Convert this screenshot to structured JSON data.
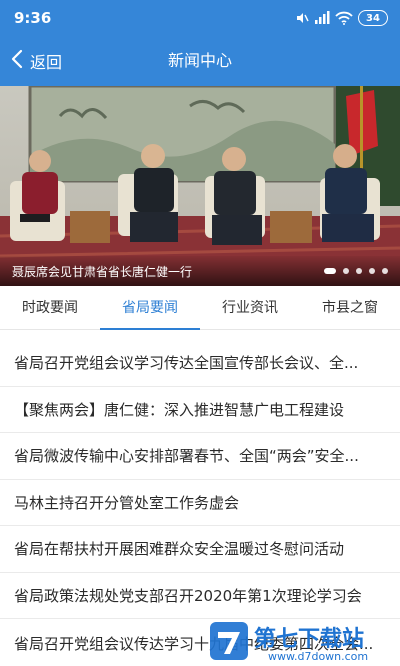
{
  "status_bar": {
    "time": "9:36",
    "battery": "34",
    "icons": [
      "mute-icon",
      "signal-icon",
      "wifi-icon",
      "battery-icon"
    ]
  },
  "nav": {
    "back_label": "返回",
    "title": "新闻中心"
  },
  "banner": {
    "caption": "聂辰席会见甘肃省省长唐仁健一行",
    "slide_count": 5,
    "active_slide": 0
  },
  "tabs": [
    {
      "label": "时政要闻",
      "active": false
    },
    {
      "label": "省局要闻",
      "active": true
    },
    {
      "label": "行业资讯",
      "active": false
    },
    {
      "label": "市县之窗",
      "active": false
    }
  ],
  "news": [
    "省局召开党组会议学习传达全国宣传部长会议、全...",
    "【聚焦两会】唐仁健：深入推进智慧广电工程建设",
    "省局微波传输中心安排部署春节、全国“两会”安全...",
    "马林主持召开分管处室工作务虚会",
    "省局在帮扶村开展困难群众安全温暖过冬慰问活动",
    "省局政策法规处党支部召开2020年第1次理论学习会",
    "省局召开党组会议传达学习十九届中纪委第四次全会..."
  ],
  "watermark": {
    "name": "第七下载站",
    "url": "www.d7down.com"
  },
  "colors": {
    "header": "#3586d8",
    "tab_active": "#2d7fd4",
    "watermark": "#1f73d1"
  }
}
